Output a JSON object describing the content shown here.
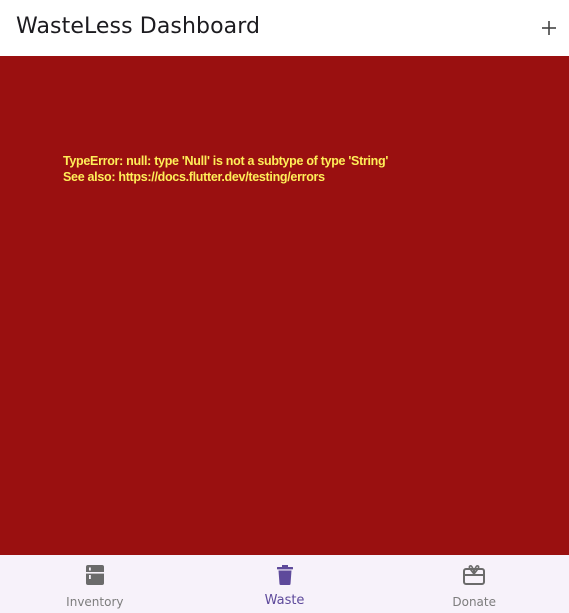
{
  "app_bar": {
    "title": "WasteLess Dashboard",
    "add_icon": "plus-icon"
  },
  "error": {
    "line1": "TypeError: null: type 'Null' is not a subtype of type 'String'",
    "line2": "See also: https://docs.flutter.dev/testing/errors",
    "background_color": "#9a1010",
    "text_color": "#ffee58"
  },
  "bottom_nav": {
    "items": [
      {
        "label": "Inventory",
        "icon": "fridge-icon",
        "active": false
      },
      {
        "label": "Waste",
        "icon": "trash-icon",
        "active": true
      },
      {
        "label": "Donate",
        "icon": "gift-card-icon",
        "active": false
      }
    ],
    "active_color": "#5e4a9b",
    "inactive_color": "#7d7d7d"
  }
}
